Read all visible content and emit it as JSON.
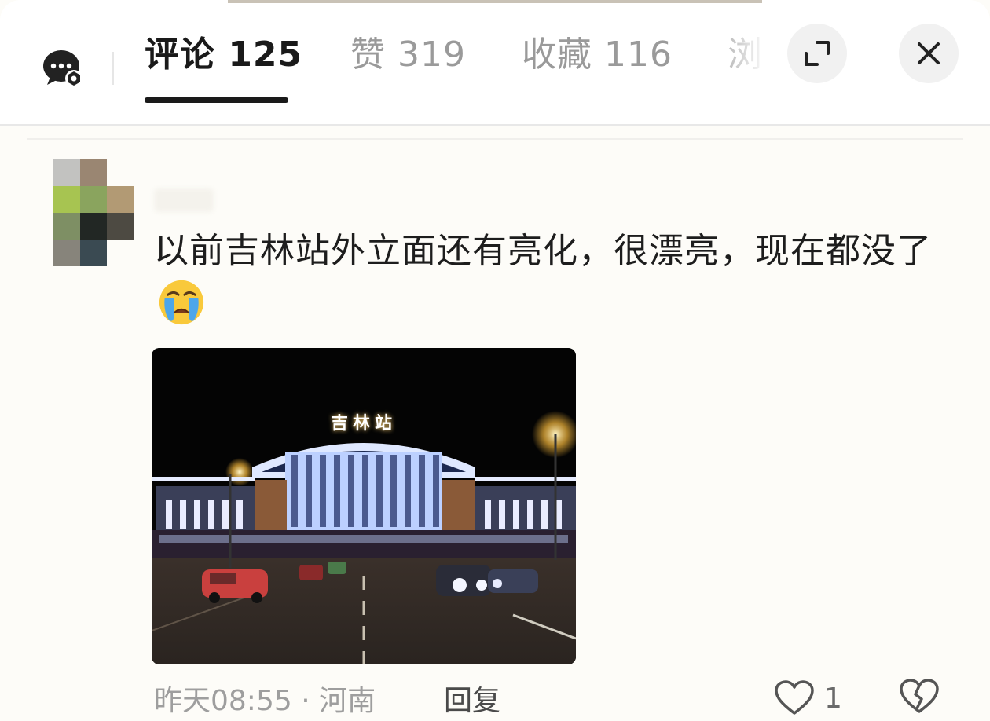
{
  "header": {
    "tabs": [
      {
        "label": "评论 125"
      },
      {
        "label": "赞 319"
      },
      {
        "label": "收藏 116"
      },
      {
        "label": "浏"
      }
    ],
    "icons": {
      "chat": "chat-settings-icon",
      "expand": "expand-icon",
      "close": "close-icon"
    }
  },
  "comment": {
    "text": "以前吉林站外立面还有亮化，很漂亮，现在都没了",
    "emoji": "crying-face-emoji",
    "image": {
      "sign": "吉林站"
    },
    "meta": "昨天08:55 · 河南",
    "reply_label": "回复",
    "like_count": "1",
    "colors": {
      "accent": "#1a1a1a",
      "muted": "#9e9e9e"
    }
  }
}
